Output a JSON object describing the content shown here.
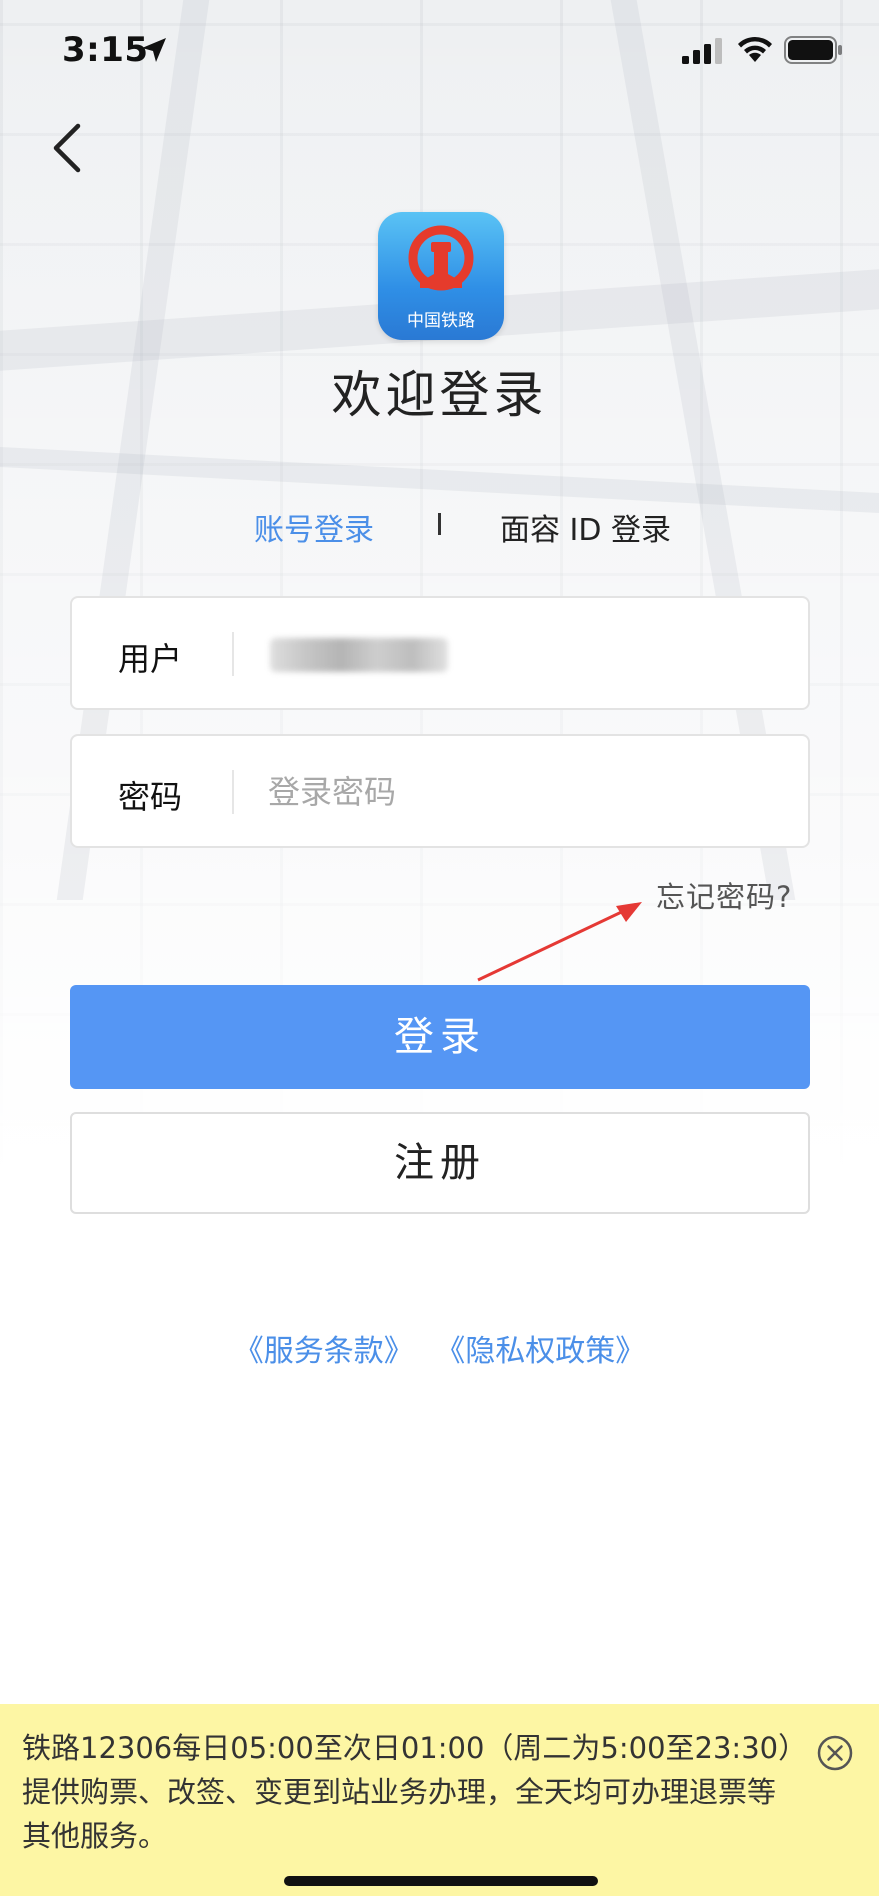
{
  "status_bar": {
    "time": "3:15",
    "icons": [
      "location-arrow-icon",
      "cellular-signal-icon",
      "wifi-icon",
      "battery-icon"
    ]
  },
  "header": {
    "back_icon": "chevron-left-icon",
    "logo_text": "中国铁路",
    "welcome": "欢迎登录"
  },
  "tabs": {
    "account_label": "账号登录",
    "face_label": "面容 ID 登录",
    "active": "account"
  },
  "form": {
    "user_label": "用户",
    "user_value_hidden": true,
    "password_label": "密码",
    "password_placeholder": "登录密码",
    "forgot_label": "忘记密码?"
  },
  "buttons": {
    "login_label": "登录",
    "register_label": "注册"
  },
  "links": {
    "terms": "《服务条款》",
    "privacy": "《隐私权政策》"
  },
  "notice": {
    "text": "铁路12306每日05:00至次日01:00（周二为5:00至23:30）提供购票、改签、变更到站业务办理，全天均可办理退票等其他服务。",
    "close_icon": "close-circle-icon"
  },
  "colors": {
    "accent": "#4b8fe8",
    "login_button": "#5596f4",
    "notice_bg": "#fdf6a4",
    "annotation_arrow": "#e53935"
  }
}
